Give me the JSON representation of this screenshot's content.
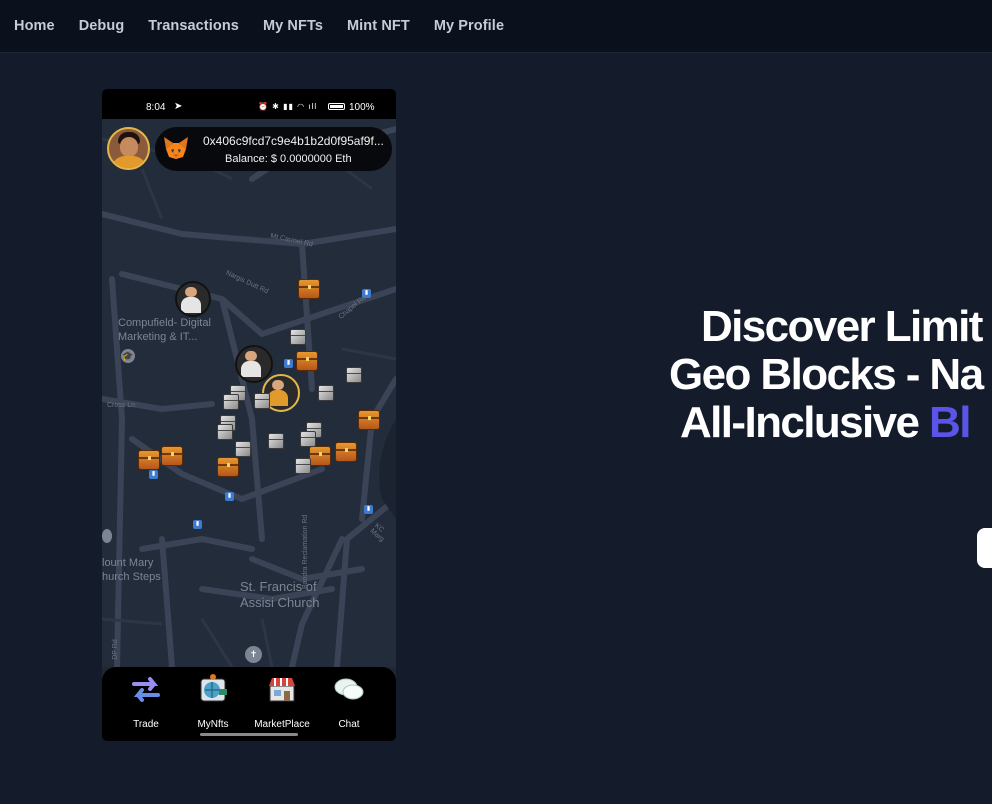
{
  "nav": {
    "items": [
      "Home",
      "Debug",
      "Transactions",
      "My NFTs",
      "Mint NFT",
      "My Profile"
    ]
  },
  "phone": {
    "status": {
      "time": "8:04",
      "icons": "⏰ ✱ ▮▮ ◠ ıll",
      "battery": "100%"
    },
    "wallet": {
      "address": "0x406c9fcd7c9e4b1b2d0f95af9f...",
      "balance": "Balance: $ 0.0000000 Eth"
    },
    "map": {
      "places": {
        "compufield": "Compufield- Digital Marketing & IT...",
        "mount_mary": "lount Mary hurch Steps",
        "st_francis": "St. Francis of Assisi Church"
      },
      "roads": {
        "mt_carmel": "Mt Carmel Rd",
        "cross_ln": "Cross Ln",
        "dp_rd": "DP Rd",
        "bandra": "Bandra Reclamation Rd",
        "kc_marg": "KC Marg",
        "chapel": "Chapel Rd",
        "nargis": "Nargis Dutt Rd"
      }
    },
    "tabs": [
      {
        "label": "Trade",
        "icon": "trade-arrows-icon"
      },
      {
        "label": "MyNfts",
        "icon": "nft-globe-icon"
      },
      {
        "label": "MarketPlace",
        "icon": "marketplace-store-icon"
      },
      {
        "label": "Chat",
        "icon": "chat-bubbles-icon"
      }
    ]
  },
  "hero": {
    "line1": "Discover Limit",
    "line2": "Geo Blocks - Na",
    "line3_prefix": "All-Inclusive ",
    "line3_accent": "Bl"
  },
  "colors": {
    "background": "#141b2b",
    "nav_background": "#0b111c",
    "accent": "#5b54e8"
  }
}
